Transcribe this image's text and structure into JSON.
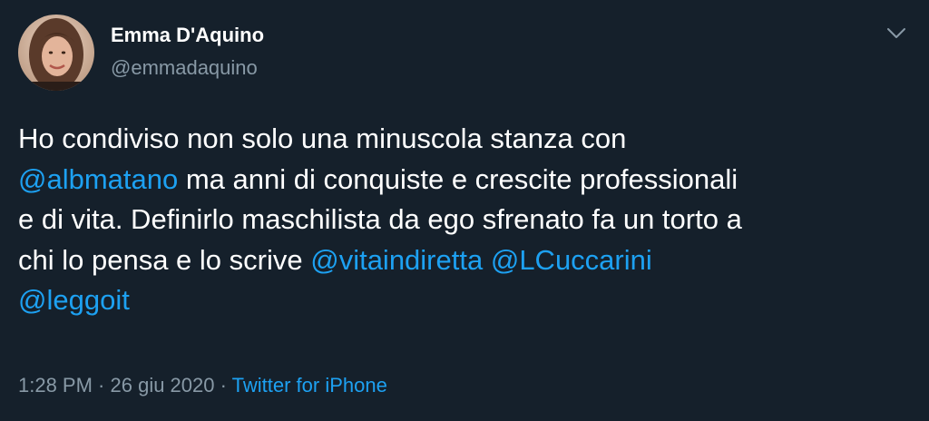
{
  "author": {
    "name": "Emma D'Aquino",
    "handle": "@emmadaquino"
  },
  "menu_icon": "chevron-down-icon",
  "tweet": {
    "line1": {
      "text": "Ho condiviso non solo una minuscola stanza con"
    },
    "line2": {
      "mention": "@albmatano",
      "text": " ma anni di conquiste e crescite professionali"
    },
    "line3": {
      "text": "e di vita. Definirlo maschilista da ego sfrenato fa un torto a"
    },
    "line4": {
      "text": "chi lo pensa e lo scrive ",
      "mention1": "@vitaindiretta",
      "space": " ",
      "mention2": "@LCuccarini"
    },
    "line5": {
      "mention": "@leggoit"
    }
  },
  "meta": {
    "time": "1:28 PM",
    "separator1": " · ",
    "date": "26 giu 2020",
    "separator2": " · ",
    "source": "Twitter for iPhone"
  },
  "colors": {
    "background": "#15202b",
    "text": "#ffffff",
    "secondary": "#8899a6",
    "link": "#1da1f2"
  }
}
